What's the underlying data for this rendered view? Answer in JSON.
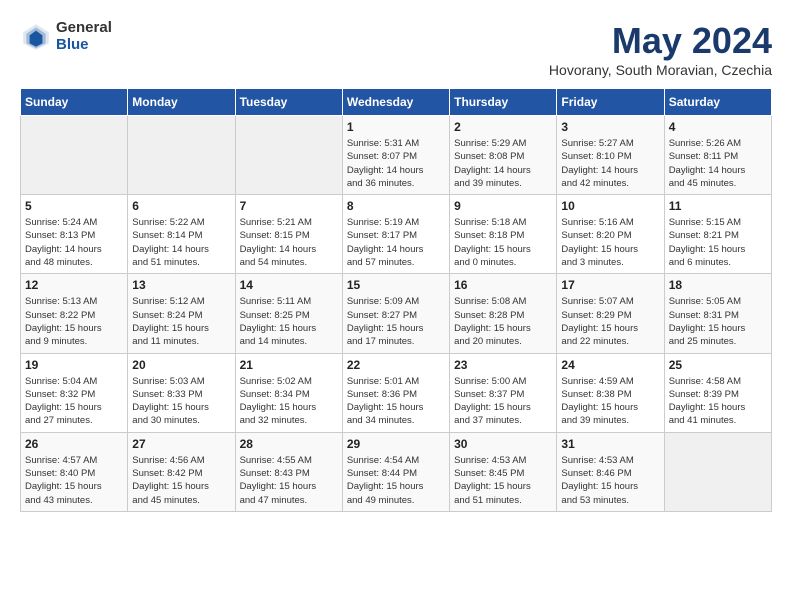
{
  "logo": {
    "general": "General",
    "blue": "Blue"
  },
  "title": {
    "month_year": "May 2024",
    "location": "Hovorany, South Moravian, Czechia"
  },
  "days_of_week": [
    "Sunday",
    "Monday",
    "Tuesday",
    "Wednesday",
    "Thursday",
    "Friday",
    "Saturday"
  ],
  "weeks": [
    [
      {
        "day": "",
        "info": ""
      },
      {
        "day": "",
        "info": ""
      },
      {
        "day": "",
        "info": ""
      },
      {
        "day": "1",
        "info": "Sunrise: 5:31 AM\nSunset: 8:07 PM\nDaylight: 14 hours\nand 36 minutes."
      },
      {
        "day": "2",
        "info": "Sunrise: 5:29 AM\nSunset: 8:08 PM\nDaylight: 14 hours\nand 39 minutes."
      },
      {
        "day": "3",
        "info": "Sunrise: 5:27 AM\nSunset: 8:10 PM\nDaylight: 14 hours\nand 42 minutes."
      },
      {
        "day": "4",
        "info": "Sunrise: 5:26 AM\nSunset: 8:11 PM\nDaylight: 14 hours\nand 45 minutes."
      }
    ],
    [
      {
        "day": "5",
        "info": "Sunrise: 5:24 AM\nSunset: 8:13 PM\nDaylight: 14 hours\nand 48 minutes."
      },
      {
        "day": "6",
        "info": "Sunrise: 5:22 AM\nSunset: 8:14 PM\nDaylight: 14 hours\nand 51 minutes."
      },
      {
        "day": "7",
        "info": "Sunrise: 5:21 AM\nSunset: 8:15 PM\nDaylight: 14 hours\nand 54 minutes."
      },
      {
        "day": "8",
        "info": "Sunrise: 5:19 AM\nSunset: 8:17 PM\nDaylight: 14 hours\nand 57 minutes."
      },
      {
        "day": "9",
        "info": "Sunrise: 5:18 AM\nSunset: 8:18 PM\nDaylight: 15 hours\nand 0 minutes."
      },
      {
        "day": "10",
        "info": "Sunrise: 5:16 AM\nSunset: 8:20 PM\nDaylight: 15 hours\nand 3 minutes."
      },
      {
        "day": "11",
        "info": "Sunrise: 5:15 AM\nSunset: 8:21 PM\nDaylight: 15 hours\nand 6 minutes."
      }
    ],
    [
      {
        "day": "12",
        "info": "Sunrise: 5:13 AM\nSunset: 8:22 PM\nDaylight: 15 hours\nand 9 minutes."
      },
      {
        "day": "13",
        "info": "Sunrise: 5:12 AM\nSunset: 8:24 PM\nDaylight: 15 hours\nand 11 minutes."
      },
      {
        "day": "14",
        "info": "Sunrise: 5:11 AM\nSunset: 8:25 PM\nDaylight: 15 hours\nand 14 minutes."
      },
      {
        "day": "15",
        "info": "Sunrise: 5:09 AM\nSunset: 8:27 PM\nDaylight: 15 hours\nand 17 minutes."
      },
      {
        "day": "16",
        "info": "Sunrise: 5:08 AM\nSunset: 8:28 PM\nDaylight: 15 hours\nand 20 minutes."
      },
      {
        "day": "17",
        "info": "Sunrise: 5:07 AM\nSunset: 8:29 PM\nDaylight: 15 hours\nand 22 minutes."
      },
      {
        "day": "18",
        "info": "Sunrise: 5:05 AM\nSunset: 8:31 PM\nDaylight: 15 hours\nand 25 minutes."
      }
    ],
    [
      {
        "day": "19",
        "info": "Sunrise: 5:04 AM\nSunset: 8:32 PM\nDaylight: 15 hours\nand 27 minutes."
      },
      {
        "day": "20",
        "info": "Sunrise: 5:03 AM\nSunset: 8:33 PM\nDaylight: 15 hours\nand 30 minutes."
      },
      {
        "day": "21",
        "info": "Sunrise: 5:02 AM\nSunset: 8:34 PM\nDaylight: 15 hours\nand 32 minutes."
      },
      {
        "day": "22",
        "info": "Sunrise: 5:01 AM\nSunset: 8:36 PM\nDaylight: 15 hours\nand 34 minutes."
      },
      {
        "day": "23",
        "info": "Sunrise: 5:00 AM\nSunset: 8:37 PM\nDaylight: 15 hours\nand 37 minutes."
      },
      {
        "day": "24",
        "info": "Sunrise: 4:59 AM\nSunset: 8:38 PM\nDaylight: 15 hours\nand 39 minutes."
      },
      {
        "day": "25",
        "info": "Sunrise: 4:58 AM\nSunset: 8:39 PM\nDaylight: 15 hours\nand 41 minutes."
      }
    ],
    [
      {
        "day": "26",
        "info": "Sunrise: 4:57 AM\nSunset: 8:40 PM\nDaylight: 15 hours\nand 43 minutes."
      },
      {
        "day": "27",
        "info": "Sunrise: 4:56 AM\nSunset: 8:42 PM\nDaylight: 15 hours\nand 45 minutes."
      },
      {
        "day": "28",
        "info": "Sunrise: 4:55 AM\nSunset: 8:43 PM\nDaylight: 15 hours\nand 47 minutes."
      },
      {
        "day": "29",
        "info": "Sunrise: 4:54 AM\nSunset: 8:44 PM\nDaylight: 15 hours\nand 49 minutes."
      },
      {
        "day": "30",
        "info": "Sunrise: 4:53 AM\nSunset: 8:45 PM\nDaylight: 15 hours\nand 51 minutes."
      },
      {
        "day": "31",
        "info": "Sunrise: 4:53 AM\nSunset: 8:46 PM\nDaylight: 15 hours\nand 53 minutes."
      },
      {
        "day": "",
        "info": ""
      }
    ]
  ]
}
